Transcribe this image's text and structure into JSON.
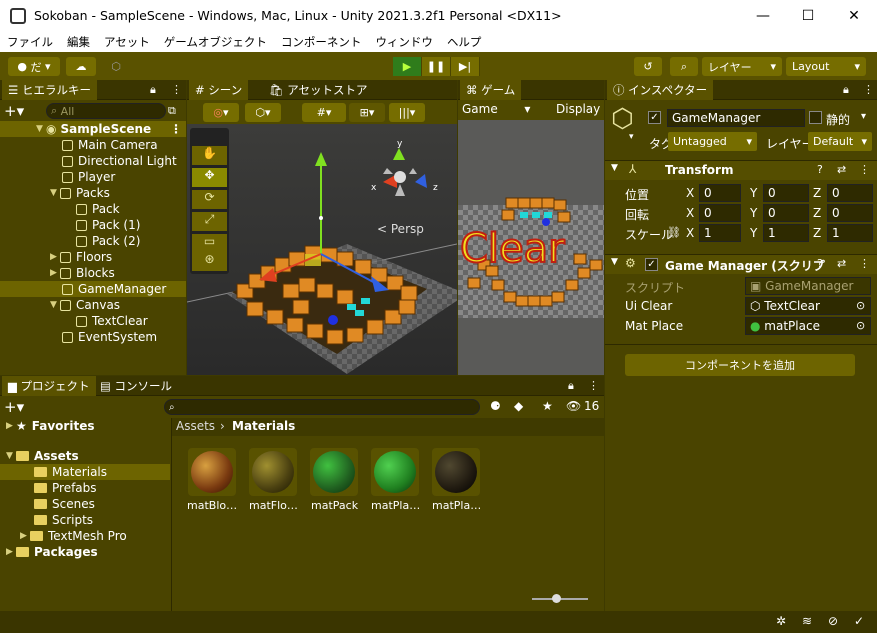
{
  "window": {
    "title": "Sokoban - SampleScene - Windows, Mac, Linux - Unity 2021.3.2f1 Personal <DX11>",
    "min": "—",
    "max": "☐",
    "close": "✕"
  },
  "menu": [
    "ファイル",
    "編集",
    "アセット",
    "ゲームオブジェクト",
    "コンポーネント",
    "ウィンドウ",
    "ヘルプ"
  ],
  "toolbar": {
    "account": "だ",
    "layers": "レイヤー",
    "layout": "Layout"
  },
  "hierarchy": {
    "tab": "ヒエラルキー",
    "search_placeholder": "All",
    "scene": "SampleScene",
    "items": [
      {
        "label": "Main Camera"
      },
      {
        "label": "Directional Light"
      },
      {
        "label": "Player"
      },
      {
        "label": "Packs"
      },
      {
        "label": "Pack"
      },
      {
        "label": "Pack (1)"
      },
      {
        "label": "Pack (2)"
      },
      {
        "label": "Floors"
      },
      {
        "label": "Blocks"
      },
      {
        "label": "GameManager"
      },
      {
        "label": "Canvas"
      },
      {
        "label": "TextClear"
      },
      {
        "label": "EventSystem"
      }
    ]
  },
  "scene": {
    "tab": "シーン",
    "tab2": "アセットストア",
    "persp": "Persp",
    "axis_x": "x",
    "axis_z": "z",
    "axis_y": "y"
  },
  "game": {
    "tab": "ゲーム",
    "display_label": "Game",
    "display": "Display",
    "clear_text": "Clear"
  },
  "inspector": {
    "tab": "インスペクター",
    "object_name": "GameManager",
    "static": "静的",
    "tag_label": "タグ",
    "tag": "Untagged",
    "layer_label": "レイヤー",
    "layer": "Default",
    "transform": {
      "title": "Transform",
      "pos": "位置",
      "rot": "回転",
      "scale": "スケール",
      "x": "X",
      "y": "Y",
      "z": "Z",
      "pos_x": "0",
      "pos_y": "0",
      "pos_z": "0",
      "rot_x": "0",
      "rot_y": "0",
      "rot_z": "0",
      "sc_x": "1",
      "sc_y": "1",
      "sc_z": "1"
    },
    "script_comp": {
      "title": "Game Manager (スクリプ",
      "script_label": "スクリプト",
      "script": "GameManager",
      "ui_clear_label": "Ui Clear",
      "ui_clear": "TextClear",
      "mat_place_label": "Mat Place",
      "mat_place": "matPlace"
    },
    "add_component": "コンポーネントを追加"
  },
  "project": {
    "tab": "プロジェクト",
    "tab2": "コンソール",
    "favorites": "Favorites",
    "assets": "Assets",
    "folders": [
      "Materials",
      "Prefabs",
      "Scenes",
      "Scripts",
      "TextMesh Pro"
    ],
    "packages": "Packages",
    "breadcrumb_root": "Assets",
    "breadcrumb_current": "Materials",
    "count": "16",
    "materials": [
      {
        "label": "matBlo…"
      },
      {
        "label": "matFlo…"
      },
      {
        "label": "matPack"
      },
      {
        "label": "matPla…"
      },
      {
        "label": "matPla…"
      }
    ]
  }
}
